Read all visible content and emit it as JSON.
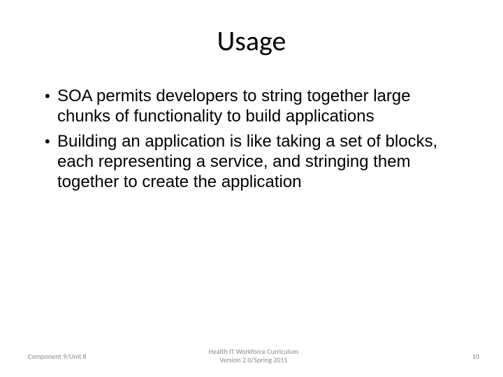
{
  "slide": {
    "title": "Usage",
    "bullets": [
      "SOA permits developers to string together large chunks of functionality to build applications",
      "Building an application is like taking a set of blocks, each representing a service, and stringing them together to create the application"
    ]
  },
  "footer": {
    "left": "Component 9/Unit 8",
    "center_line1": "Health IT Workforce Curriculum",
    "center_line2": "Version 2.0/Spring 2011",
    "right": "10"
  }
}
